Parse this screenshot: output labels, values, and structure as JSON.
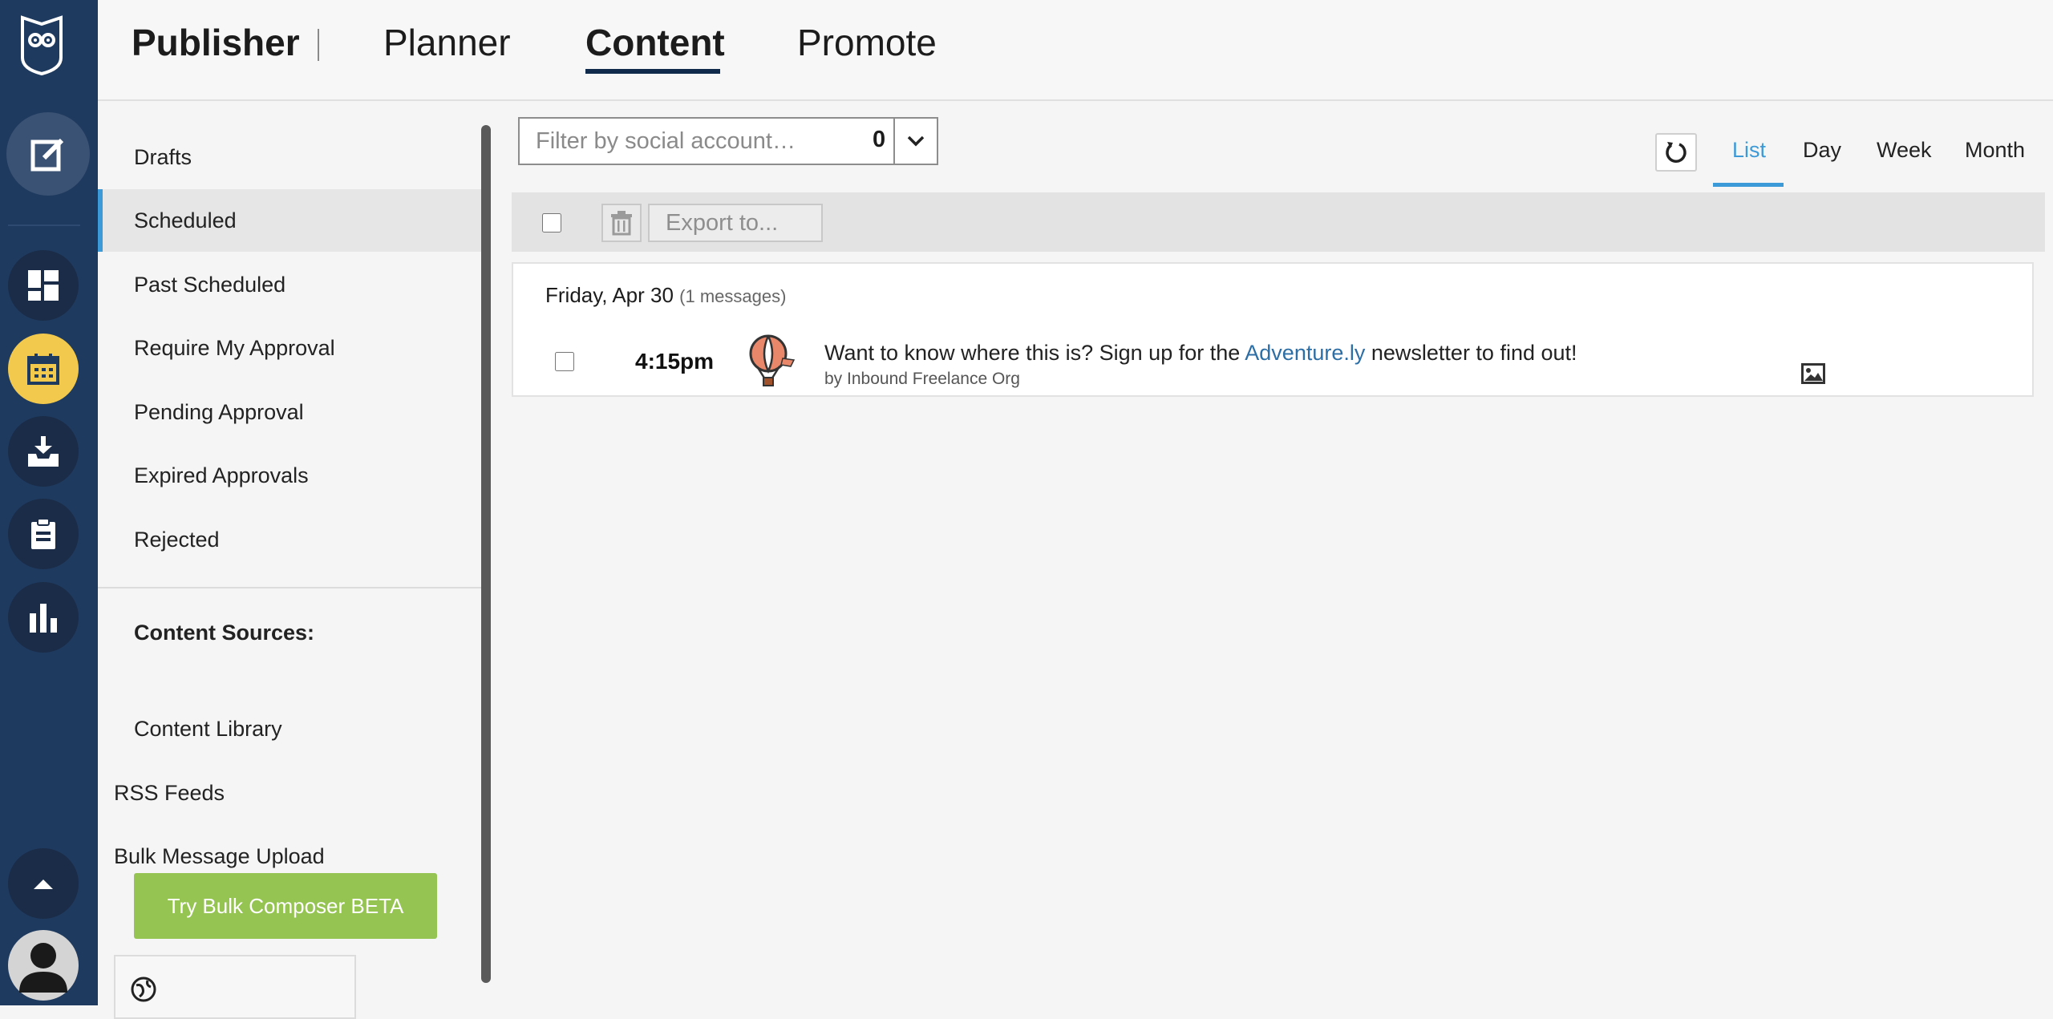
{
  "header": {
    "brand": "Publisher",
    "tabs": [
      {
        "label": "Planner"
      },
      {
        "label": "Content"
      },
      {
        "label": "Promote"
      }
    ]
  },
  "sidebar": {
    "items": [
      {
        "label": "Drafts"
      },
      {
        "label": "Scheduled"
      },
      {
        "label": "Past Scheduled"
      },
      {
        "label": "Require My Approval"
      },
      {
        "label": "Pending Approval"
      },
      {
        "label": "Expired Approvals"
      },
      {
        "label": "Rejected"
      }
    ],
    "content_sources_heading": "Content Sources:",
    "sources": [
      {
        "label": "Content Library"
      },
      {
        "label": "RSS Feeds"
      },
      {
        "label": "Bulk Message Upload"
      }
    ],
    "bulk_button": "Try Bulk Composer BETA"
  },
  "filter": {
    "placeholder": "Filter by social account…",
    "count": "0"
  },
  "views": {
    "tabs": [
      {
        "label": "List"
      },
      {
        "label": "Day"
      },
      {
        "label": "Week"
      },
      {
        "label": "Month"
      }
    ],
    "active": "List"
  },
  "toolbar": {
    "export_label": "Export to..."
  },
  "messages": {
    "date": "Friday, Apr 30",
    "count_label": "(1 messages)",
    "items": [
      {
        "time": "4:15pm",
        "text_before": "Want to know where this is? Sign up for the ",
        "link": "Adventure.ly",
        "text_after": " newsletter to find out!",
        "by": "by Inbound Freelance Org"
      }
    ]
  },
  "colors": {
    "rail": "#1f3a5f",
    "accent": "#3d9ad8",
    "active_rail": "#f2c94c",
    "bulk_button": "#95c452",
    "link": "#2c6ea5"
  }
}
